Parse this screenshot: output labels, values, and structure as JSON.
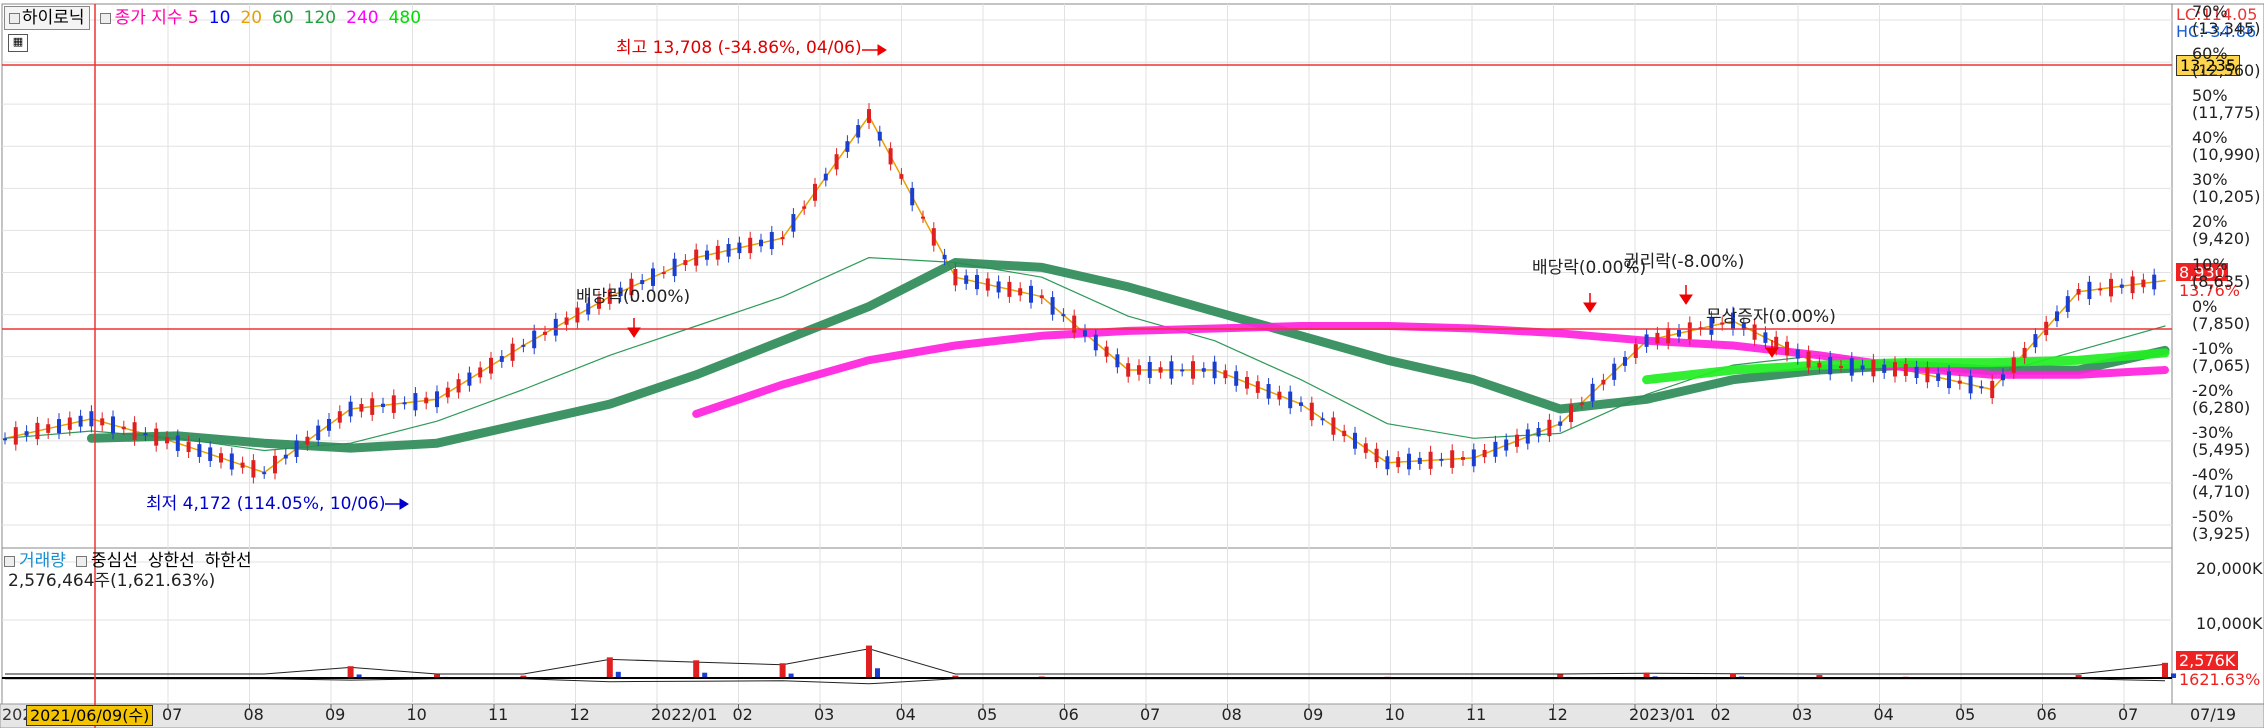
{
  "header": {
    "stock_name": "하이로닉",
    "ma_title": "종가 지수 5",
    "ma_periods": [
      {
        "label": "10",
        "color": "#0000ff"
      },
      {
        "label": "20",
        "color": "#e8a000"
      },
      {
        "label": "60",
        "color": "#20a040"
      },
      {
        "label": "120",
        "color": "#20a040"
      },
      {
        "label": "240",
        "color": "#ff00ff"
      },
      {
        "label": "480",
        "color": "#00dd00"
      }
    ],
    "ma_title_color": "#ff00aa"
  },
  "right_info": {
    "lc": "LC:114.05",
    "hc": "HC:-34.86",
    "current_price": "13,235",
    "last_price": "8,930",
    "last_pct": "13.76%"
  },
  "price_axis": {
    "labels": [
      {
        "pct": "70%",
        "price": "(13,345)"
      },
      {
        "pct": "60%",
        "price": "(12,560)"
      },
      {
        "pct": "50%",
        "price": "(11,775)"
      },
      {
        "pct": "40%",
        "price": "(10,990)"
      },
      {
        "pct": "30%",
        "price": "(10,205)"
      },
      {
        "pct": "20%",
        "price": "(9,420)"
      },
      {
        "pct": "10%",
        "price": "(8,635)"
      },
      {
        "pct": "0%",
        "price": "(7,850)"
      },
      {
        "pct": "-10%",
        "price": "(7,065)"
      },
      {
        "pct": "-20%",
        "price": "(6,280)"
      },
      {
        "pct": "-30%",
        "price": "(5,495)"
      },
      {
        "pct": "-40%",
        "price": "(4,710)"
      },
      {
        "pct": "-50%",
        "price": "(3,925)"
      }
    ]
  },
  "annotations": {
    "high": "최고 13,708 (-34.86%, 04/06)",
    "low": "최저 4,172 (114.05%, 10/06)",
    "div1": "배당락(0.00%)",
    "div2": "배당락(0.00%)",
    "rights": "권리락(-8.00%)",
    "bonus": "무상증자(0.00%)"
  },
  "volume_panel": {
    "title": "거래량",
    "legend": [
      "중심선",
      "상한선",
      "하한선"
    ],
    "value": "2,576,464주(1,621.63%)",
    "axis": [
      "20,000K",
      "10,000K"
    ],
    "last_vol": "2,576K",
    "last_pct": "1621.63%"
  },
  "time_axis": {
    "cursor_date": "2021/06/09(수)",
    "left_clip": "202",
    "labels": [
      "07",
      "08",
      "09",
      "10",
      "11",
      "12",
      "2022/01",
      "02",
      "03",
      "04",
      "05",
      "06",
      "07",
      "08",
      "09",
      "10",
      "11",
      "12",
      "2023/01",
      "02",
      "03",
      "04",
      "05",
      "06",
      "07"
    ],
    "right_label": "07/19"
  },
  "chart_data": {
    "type": "line",
    "title": "하이로닉",
    "xlabel": "",
    "ylabel": "",
    "ylim": [
      3925,
      13345
    ],
    "x": [
      "2021/06",
      "2021/07",
      "2021/08",
      "2021/09",
      "2021/10",
      "2021/11",
      "2021/12",
      "2022/01",
      "2022/02",
      "2022/03",
      "2022/04",
      "2022/05",
      "2022/06",
      "2022/07",
      "2022/08",
      "2022/09",
      "2022/10",
      "2022/11",
      "2022/12",
      "2023/01",
      "2023/02",
      "2023/03",
      "2023/04",
      "2023/05",
      "2023/06",
      "2023/07"
    ],
    "series": [
      {
        "name": "종가",
        "values": [
          5700,
          6100,
          5600,
          5000,
          6300,
          6500,
          7600,
          8600,
          9400,
          9800,
          12300,
          9000,
          8600,
          7100,
          7100,
          6400,
          5200,
          5300,
          6000,
          7700,
          8100,
          7200,
          7100,
          6700,
          8700,
          8930
        ]
      },
      {
        "name": "60",
        "values": [
          5700,
          5850,
          5700,
          5450,
          5600,
          6050,
          6700,
          7400,
          8000,
          8600,
          9400,
          9300,
          9000,
          8200,
          7700,
          6900,
          6000,
          5700,
          5800,
          6600,
          7200,
          7400,
          7200,
          7000,
          7500,
          8000
        ]
      },
      {
        "name": "120",
        "values": [
          null,
          5700,
          5750,
          5600,
          5500,
          5600,
          6000,
          6400,
          7000,
          7700,
          8400,
          9300,
          9200,
          8800,
          8300,
          7800,
          7300,
          6900,
          6300,
          6500,
          6900,
          7100,
          7200,
          7100,
          7100,
          7500
        ]
      },
      {
        "name": "240",
        "values": [
          null,
          null,
          null,
          null,
          null,
          null,
          null,
          null,
          6200,
          6800,
          7300,
          7600,
          7800,
          7900,
          7950,
          8000,
          8000,
          7950,
          7850,
          7700,
          7600,
          7400,
          7150,
          7000,
          7000,
          7100
        ]
      },
      {
        "name": "480",
        "values": [
          null,
          null,
          null,
          null,
          null,
          null,
          null,
          null,
          null,
          null,
          null,
          null,
          null,
          null,
          null,
          null,
          null,
          null,
          null,
          6900,
          7100,
          7200,
          7250,
          7250,
          7300,
          7450
        ]
      }
    ],
    "volume": {
      "unit": "K",
      "values": [
        150,
        120,
        100,
        90,
        2000,
        600,
        400,
        3500,
        3000,
        2500,
        5500,
        400,
        250,
        150,
        120,
        100,
        200,
        150,
        600,
        900,
        800,
        500,
        200,
        150,
        500,
        2576
      ]
    }
  }
}
